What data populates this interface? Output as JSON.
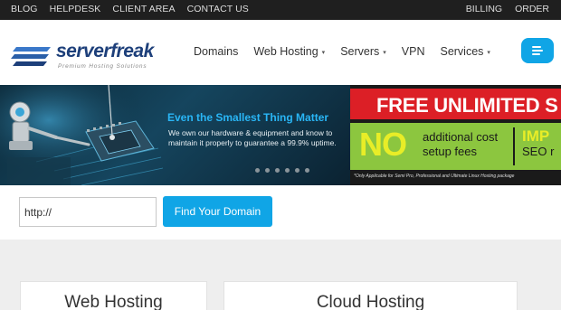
{
  "topbar": {
    "links": [
      "BLOG",
      "HELPDESK",
      "CLIENT AREA",
      "CONTACT US"
    ],
    "right_links": [
      "BILLING",
      "ORDER"
    ]
  },
  "logo": {
    "name_part1": "server",
    "name_part2": "freak",
    "tagline": "Premium Hosting Solutions"
  },
  "nav": {
    "items": [
      {
        "label": "Domains",
        "dropdown": false
      },
      {
        "label": "Web Hosting",
        "dropdown": true
      },
      {
        "label": "Servers",
        "dropdown": true
      },
      {
        "label": "VPN",
        "dropdown": false
      },
      {
        "label": "Services",
        "dropdown": true
      }
    ],
    "caret": "▾",
    "menu_icon": "menu-icon"
  },
  "banner_left": {
    "title": "Even the Smallest Thing Matter",
    "text": "We own our hardware & equipment and know to maintain it properly to guarantee a 99.9% uptime.",
    "slide_count": 6
  },
  "banner_right": {
    "headline": "FREE UNLIMITED S",
    "no": "NO",
    "no_desc_1": "additional cost",
    "no_desc_2": "setup fees",
    "imp": "IMP",
    "seo": "SEO r",
    "note": "*Only Applicable for Semi Pro, Professional and Ultimate Linux Hosting package"
  },
  "domain_search": {
    "value": "http://",
    "button_label": "Find Your Domain"
  },
  "hosting": {
    "cards": [
      "Web Hosting",
      "Cloud Hosting"
    ]
  },
  "colors": {
    "accent": "#10a5e6",
    "topbar": "#1f1f1f",
    "logo": "#1d3f7a",
    "red": "#dc1f26",
    "green": "#8cc63f",
    "yellow": "#e8ed27"
  }
}
